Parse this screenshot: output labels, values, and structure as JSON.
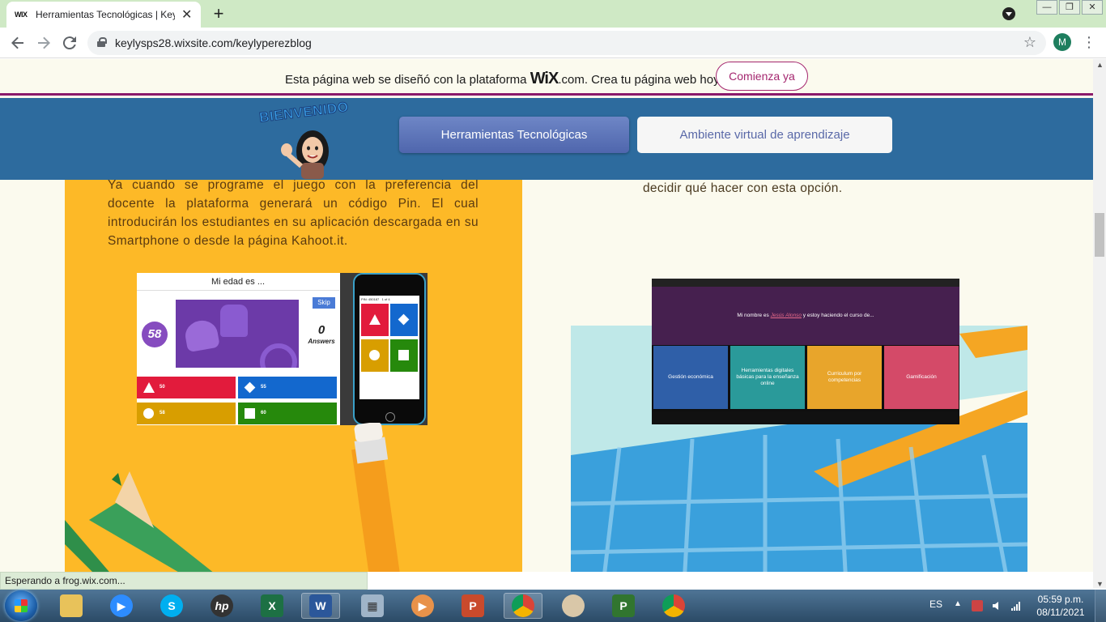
{
  "browser": {
    "tab_favicon": "WIX",
    "tab_title": "Herramientas Tecnológicas | Keyl",
    "tab_close": "✕",
    "new_tab": "+",
    "url": "keylysps28.wixsite.com/keylyperezblog",
    "profile_initial": "M",
    "window_buttons": [
      "—",
      "❐",
      "✕"
    ],
    "icons": [
      "back-arrow-icon",
      "forward-arrow-icon",
      "reload-icon",
      "lock-icon",
      "star-icon",
      "menu-dots-icon"
    ]
  },
  "wix_banner": {
    "text_before": "Esta página web se diseñó con la plataforma ",
    "brand": "WiX",
    "text_after": ".com. Crea tu página web hoy.",
    "cta": "Comienza ya"
  },
  "site_header": {
    "welcome": "BIENVENIDO",
    "nav": [
      "Herramientas Tecnológicas",
      "Ambiente virtual de aprendizaje"
    ],
    "active_nav": 0
  },
  "left_panel": {
    "paragraph": "Ya cuando se programe el juego con la preferencia del docente la plataforma generará un código Pin. El cual introducirán los estudiantes en su aplicación descargada en su Smartphone o desde la página Kahoot.it.",
    "kahoot_screen": {
      "question": "Mi edad es ...",
      "timer": "58",
      "skip": "Skip",
      "answers_count": "0",
      "answers_label": "Answers",
      "options": [
        "50",
        "55",
        "58",
        "60"
      ],
      "phone_pin": "PIN: 450187",
      "phone_page": "1 of 4"
    }
  },
  "right_panel": {
    "paragraph": "decidir qué hacer con esta opción.",
    "quiz": {
      "question_before": "Mi nombre es ",
      "question_name": "Jesús Alonso",
      "question_after": " y estoy haciendo el curso de...",
      "options": [
        "Gestión económica",
        "Herramientas digitales básicas para la enseñanza online",
        "Curriculum por competencias",
        "Gamificación"
      ]
    }
  },
  "status_bar": "Esperando a frog.wix.com...",
  "taskbar": {
    "apps": [
      "file-explorer-icon",
      "zoom-icon",
      "skype-icon",
      "hp-icon",
      "excel-icon",
      "word-icon",
      "calculator-icon",
      "media-player-icon",
      "powerpoint-icon",
      "chrome-profile-icon",
      "paint-icon",
      "project-icon",
      "chrome-icon"
    ],
    "language": "ES",
    "time": "05:59 p.m.",
    "date": "08/11/2021"
  },
  "colors": {
    "tabbar": "#cfe9c5",
    "wix_accent": "#a4266f",
    "header_blue": "#2d6b9e",
    "nav_active": "#5a72b8",
    "left_panel": "#fdb927",
    "kahoot_red": "#e21b3c",
    "kahoot_blue": "#1368ce",
    "kahoot_yellow": "#d89e00",
    "kahoot_green": "#26890c"
  }
}
